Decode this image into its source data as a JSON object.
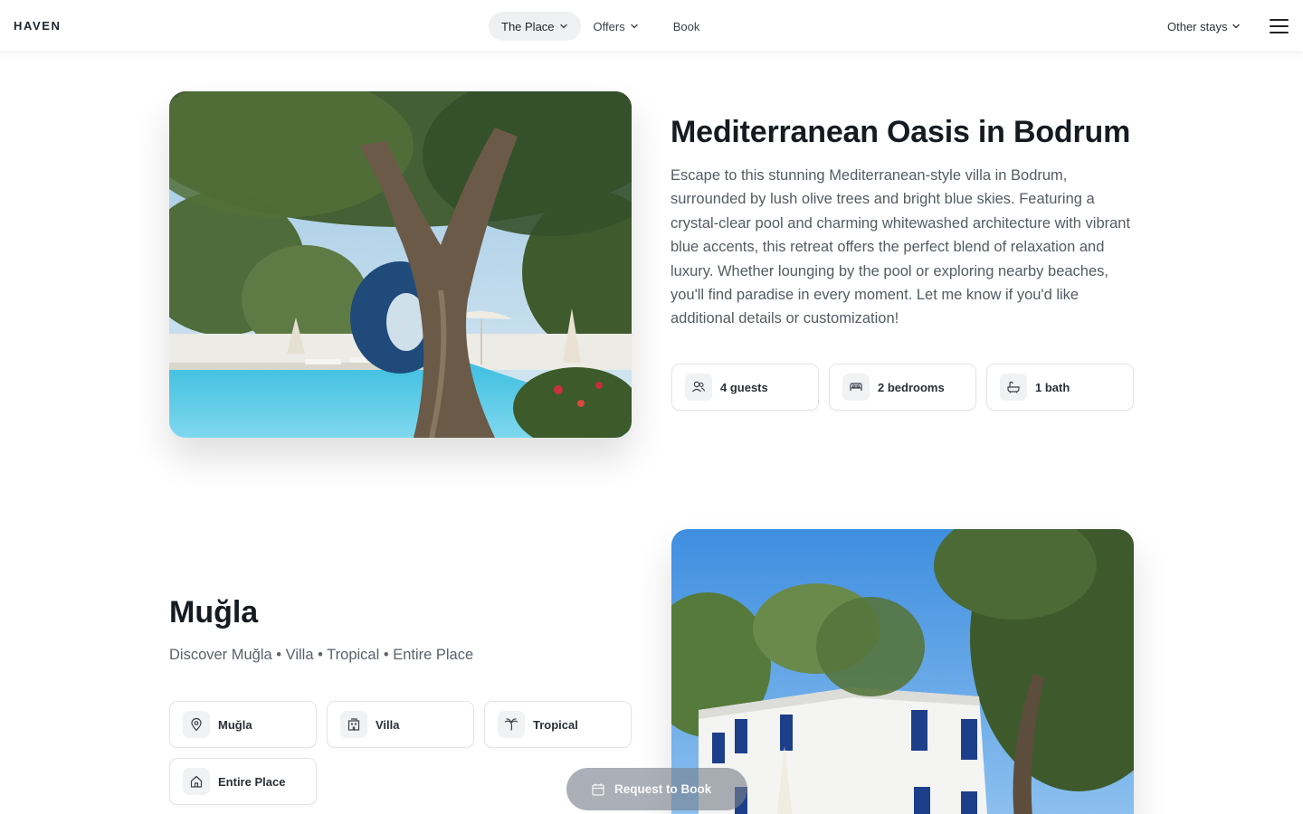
{
  "header": {
    "logo": "HAVEN",
    "nav": [
      {
        "label": "The Place",
        "has_dropdown": true,
        "active": true
      },
      {
        "label": "Offers",
        "has_dropdown": true,
        "active": false
      },
      {
        "label": "Book",
        "has_dropdown": false,
        "active": false
      }
    ],
    "other_stays": "Other stays",
    "menu_icon": "hamburger-menu-icon"
  },
  "listing": {
    "title": "Mediterranean Oasis in Bodrum",
    "description": "Escape to this stunning Mediterranean-style villa in Bodrum, surrounded by lush olive trees and bright blue skies. Featuring a crystal-clear pool and charming whitewashed architecture with vibrant blue accents, this retreat offers the perfect blend of relaxation and luxury. Whether lounging by the pool or exploring nearby beaches, you'll find paradise in every moment. Let me know if you'd like additional details or customization!",
    "features": [
      {
        "label": "4 guests",
        "icon": "users-icon"
      },
      {
        "label": "2 bedrooms",
        "icon": "bed-icon"
      },
      {
        "label": "1 bath",
        "icon": "bath-icon"
      }
    ]
  },
  "location": {
    "name": "Muğla",
    "subline": "Discover Muğla • Villa • Tropical • Entire Place",
    "tags": [
      {
        "label": "Muğla",
        "icon": "map-pin-icon"
      },
      {
        "label": "Villa",
        "icon": "building-icon"
      },
      {
        "label": "Tropical",
        "icon": "palm-tree-icon"
      },
      {
        "label": "Entire Place",
        "icon": "home-icon"
      }
    ]
  },
  "cta": {
    "label": "Request to Book",
    "icon": "calendar-icon"
  },
  "colors": {
    "text_primary": "#161b22",
    "text_secondary": "#555b63",
    "chip_border": "#e2e5e8",
    "nav_active_bg": "#eef0f2"
  }
}
